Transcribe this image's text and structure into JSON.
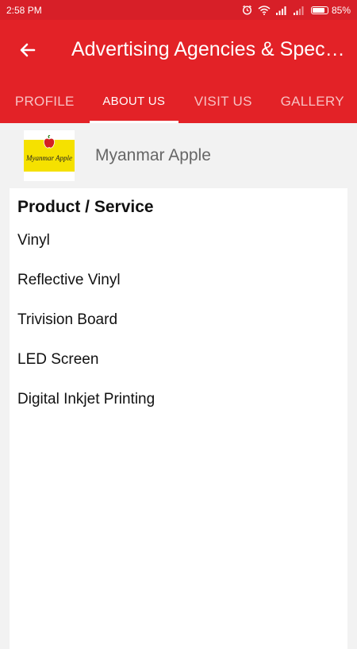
{
  "status_bar": {
    "time": "2:58 PM",
    "battery": "85%",
    "battery_level": 0.85
  },
  "app_bar": {
    "title": "Advertising Agencies & Specialists",
    "back_icon": "arrow-left-icon"
  },
  "tabs": [
    {
      "label": "PROFILE",
      "active": false
    },
    {
      "label": "ABOUT US",
      "active": true
    },
    {
      "label": "VISIT US",
      "active": false
    },
    {
      "label": "GALLERY",
      "active": false
    }
  ],
  "company": {
    "name": "Myanmar Apple",
    "logo_text": "Myanmar Apple"
  },
  "products": {
    "heading": "Product / Service",
    "items": [
      "Vinyl",
      "Reflective Vinyl",
      "Trivision Board",
      "LED Screen",
      "Digital Inkjet Printing"
    ]
  },
  "colors": {
    "primary": "#e32227",
    "status_bar": "#d71f28",
    "background": "#f2f2f2"
  }
}
